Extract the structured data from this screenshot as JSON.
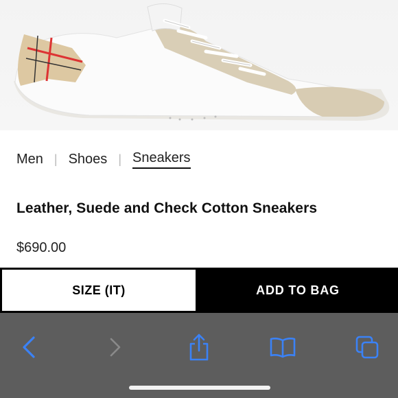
{
  "breadcrumb": {
    "items": [
      "Men",
      "Shoes",
      "Sneakers"
    ]
  },
  "product": {
    "title": "Leather, Suede and Check Cotton Sneakers",
    "price": "$690.00"
  },
  "actions": {
    "size_label": "SIZE (IT)",
    "add_to_bag_label": "ADD TO BAG"
  },
  "browser_toolbar": {
    "icons": [
      "back-icon",
      "forward-icon",
      "share-icon",
      "bookmarks-icon",
      "tabs-icon"
    ],
    "accent_color": "#3b82f6",
    "disabled_color": "#8a8a8a"
  }
}
